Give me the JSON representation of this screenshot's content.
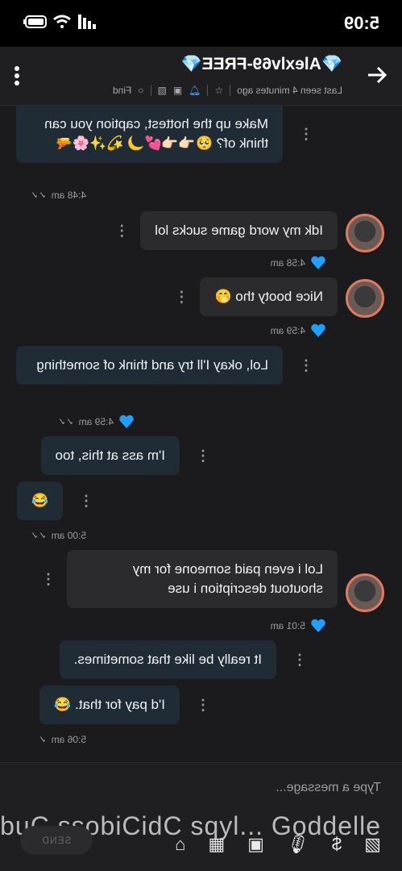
{
  "status": {
    "time": "5:09"
  },
  "header": {
    "title": "💎Alexlv69-FREE💎",
    "last_seen": "Last seen 4 minutes ago",
    "find": "Find"
  },
  "messages": [
    {
      "text": "Make up the hottest, caption you can think of? 🥺👈🏻👈🏻💕🌙 💫✨🌸🔫",
      "time": "4:48 am"
    },
    {
      "text": "Idk my word game sucks lol",
      "time": "4:58 am"
    },
    {
      "text": "Nice booty tho 🤭",
      "time": "4:59 am"
    },
    {
      "text": "Lol, okay I'll try and think of something",
      "time": "4:59 am"
    },
    {
      "text": "I'm ass at this, too",
      "time": ""
    },
    {
      "text": "😂",
      "time": "5:00 am"
    },
    {
      "text": "Lol i even paid someone for my shoutout description i use",
      "time": "5:01 am"
    },
    {
      "text": "It really be like that sometimes.",
      "time": ""
    },
    {
      "text": "I'd pay for that. 😂",
      "time": "5:06 am"
    }
  ],
  "composer": {
    "placeholder": "Type a message...",
    "tools_text": "elbbuC ssobiCidC sqyl... Goddelle",
    "send": "SEND"
  }
}
